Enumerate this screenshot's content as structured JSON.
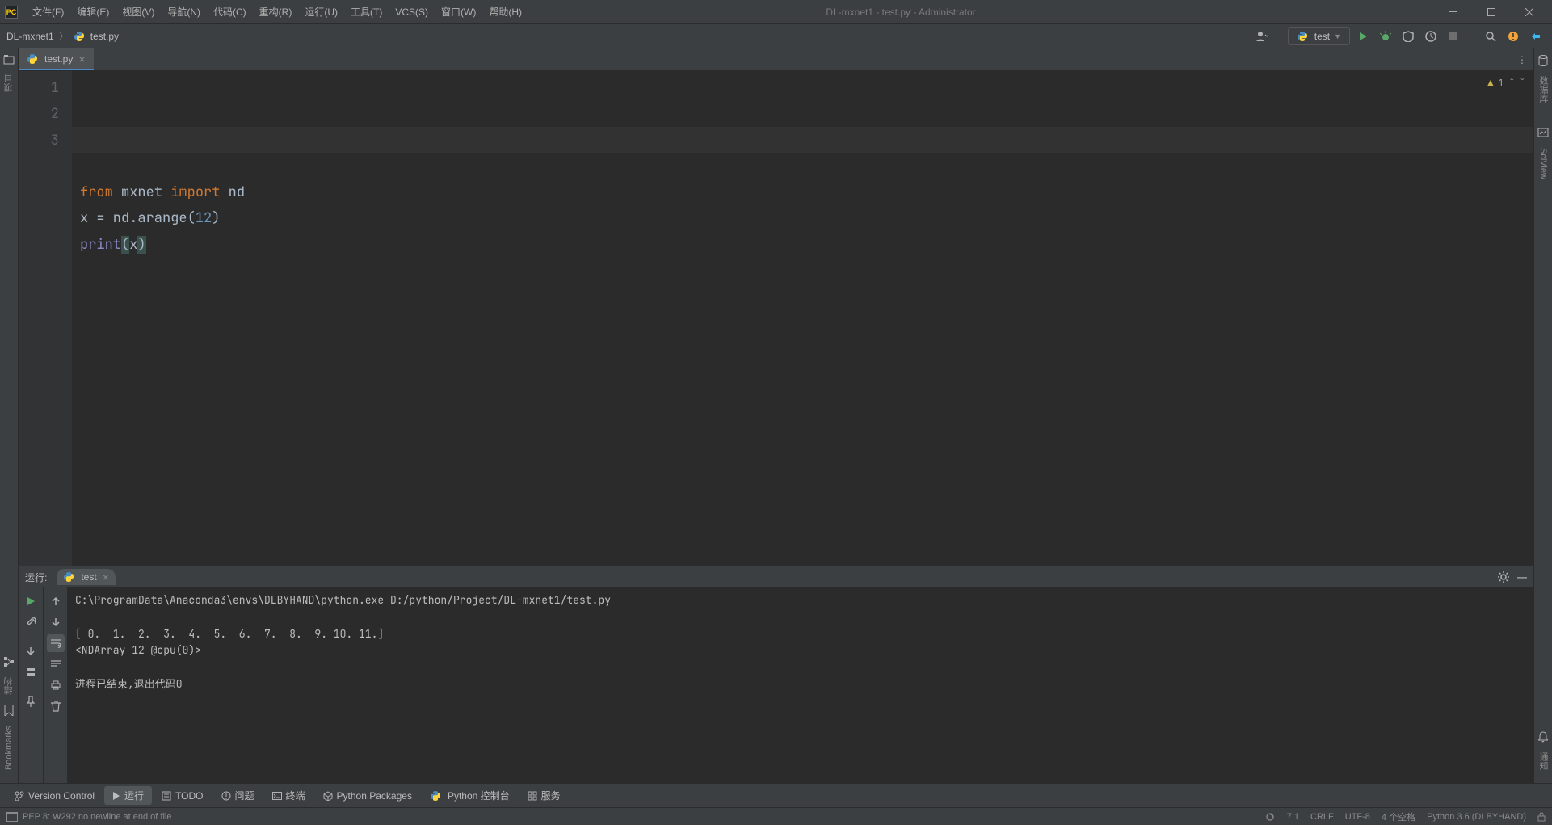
{
  "window": {
    "title": "DL-mxnet1 - test.py - Administrator"
  },
  "menu": {
    "file": "文件(F)",
    "edit": "编辑(E)",
    "view": "视图(V)",
    "navigate": "导航(N)",
    "code": "代码(C)",
    "refactor": "重构(R)",
    "run": "运行(U)",
    "tools": "工具(T)",
    "vcs": "VCS(S)",
    "window": "窗口(W)",
    "help": "帮助(H)"
  },
  "breadcrumb": {
    "project": "DL-mxnet1",
    "file": "test.py"
  },
  "run_config": {
    "label": "test"
  },
  "editor": {
    "tab": "test.py",
    "lines": [
      "1",
      "2",
      "3"
    ],
    "code": {
      "l1_from": "from",
      "l1_mxnet": "mxnet",
      "l1_import": "import",
      "l1_nd": "nd",
      "l2_x": "x",
      "l2_eq": "= nd.arange(",
      "l2_num": "12",
      "l2_close": ")",
      "l3_print": "print",
      "l3_open": "(",
      "l3_x": "x",
      "l3_close": ")"
    },
    "inspection_count": "1"
  },
  "left_sidebar": {
    "project": "项目",
    "structure": "结构",
    "bookmarks": "Bookmarks"
  },
  "right_sidebar": {
    "notifications": "通知",
    "sciview": "SciView",
    "database": "数据库"
  },
  "run_panel": {
    "header": "运行:",
    "tab": "test",
    "console_line1": "C:\\ProgramData\\Anaconda3\\envs\\DLBYHAND\\python.exe D:/python/Project/DL-mxnet1/test.py",
    "console_line2": "",
    "console_line3": "[ 0.  1.  2.  3.  4.  5.  6.  7.  8.  9. 10. 11.]",
    "console_line4": "<NDArray 12 @cpu(0)>",
    "console_line5": "",
    "console_line6": "进程已结束,退出代码0"
  },
  "tool_buttons": {
    "vcs": "Version Control",
    "run": "运行",
    "todo": "TODO",
    "problems": "问题",
    "terminal": "终端",
    "packages": "Python Packages",
    "console": "Python 控制台",
    "services": "服务"
  },
  "status": {
    "pep8": "PEP 8: W292 no newline at end of file",
    "position": "7:1",
    "line_sep": "CRLF",
    "encoding": "UTF-8",
    "indent": "4 个空格",
    "interpreter": "Python 3.6 (DLBYHAND)"
  },
  "icons": {
    "play": "▶",
    "bug": "🐞",
    "gear": "⚙",
    "search": "🔍"
  }
}
